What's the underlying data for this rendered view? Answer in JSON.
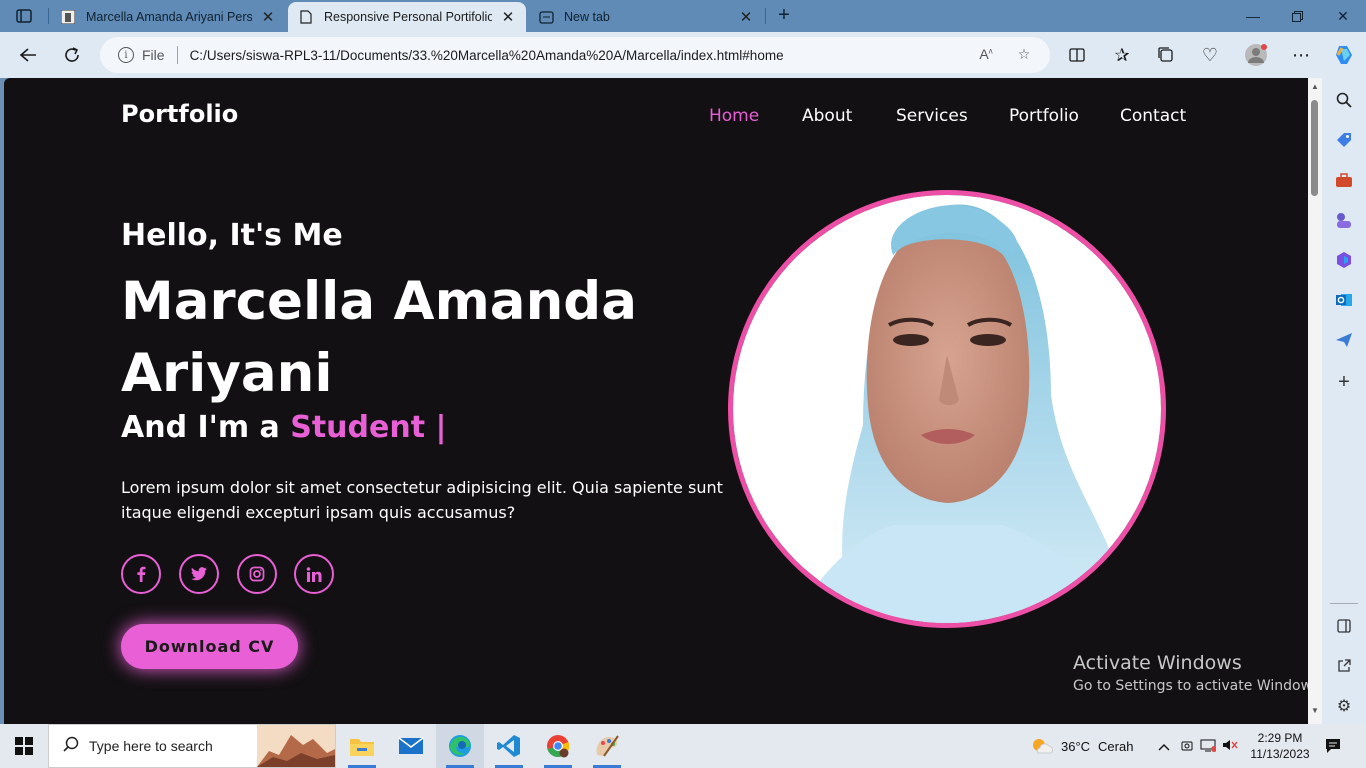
{
  "browser": {
    "tabs": [
      {
        "title": "Marcella Amanda Ariyani Personal",
        "state": "inactive"
      },
      {
        "title": "Responsive Personal Portifolio Web",
        "state": "active"
      },
      {
        "title": "New tab",
        "state": "inactive"
      }
    ],
    "address": {
      "scheme_label": "File",
      "url": "C:/Users/siswa-RPL3-11/Documents/33.%20Marcella%20Amanda%20A/Marcella/index.html#home"
    }
  },
  "site": {
    "logo": "Portfolio",
    "nav": [
      {
        "label": "Home",
        "active": true
      },
      {
        "label": "About",
        "active": false
      },
      {
        "label": "Services",
        "active": false
      },
      {
        "label": "Portfolio",
        "active": false
      },
      {
        "label": "Contact",
        "active": false
      }
    ],
    "hero": {
      "greeting": "Hello, It's Me",
      "name": "Marcella Amanda Ariyani",
      "role_prefix": "And I'm a ",
      "role_highlight": "Student |",
      "description": "Lorem ipsum dolor sit amet consectetur adipisicing elit. Quia sapiente sunt itaque eligendi excepturi ipsam quis accusamus?",
      "socials": [
        {
          "icon": "facebook-icon",
          "glyph": "f"
        },
        {
          "icon": "twitter-icon",
          "glyph": "🐦"
        },
        {
          "icon": "instagram-icon",
          "glyph": "◎"
        },
        {
          "icon": "linkedin-icon",
          "glyph": "in"
        }
      ],
      "cta_label": "Download CV"
    },
    "accent_color": "#e85fd6",
    "ring_color": "#ee4fa6"
  },
  "watermark": {
    "line1": "Activate Windows",
    "line2": "Go to Settings to activate Windows."
  },
  "taskbar": {
    "search_placeholder": "Type here to search",
    "weather_temp": "36°C",
    "weather_text": "Cerah",
    "time": "2:29 PM",
    "date": "11/13/2023"
  }
}
